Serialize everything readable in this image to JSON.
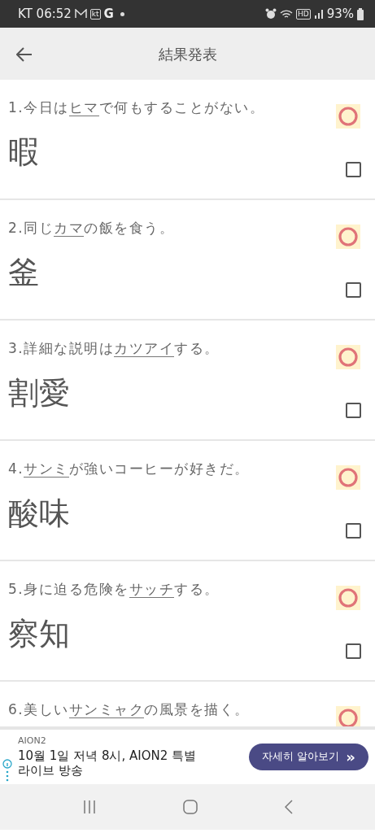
{
  "status_bar": {
    "carrier_time": "KT 06:52",
    "kt_label": "kt",
    "google_label": "G",
    "hd_label": "HD",
    "battery": "93%"
  },
  "header": {
    "title": "結果発表"
  },
  "questions": [
    {
      "number": "1.",
      "before": "今日は",
      "target": "ヒマ",
      "after": "で何もすることがない。",
      "answer": "暇",
      "correct": true,
      "checked": false
    },
    {
      "number": "2.",
      "before": "同じ",
      "target": "カマ",
      "after": "の飯を食う。",
      "answer": "釜",
      "correct": true,
      "checked": false
    },
    {
      "number": "3.",
      "before": "詳細な説明は",
      "target": "カツアイ",
      "after": "する。",
      "answer": "割愛",
      "correct": true,
      "checked": false
    },
    {
      "number": "4.",
      "target": "サンミ",
      "after": "が強いコーヒーが好きだ。",
      "answer": "酸味",
      "correct": true,
      "checked": false
    },
    {
      "number": "5.",
      "before": "身に迫る危険を",
      "target": "サッチ",
      "after": "する。",
      "answer": "察知",
      "correct": true,
      "checked": false
    },
    {
      "number": "6.",
      "before": "美しい",
      "target": "サンミャク",
      "after": "の風景を描く。",
      "correct": true
    }
  ],
  "ad": {
    "advertiser": "AION2",
    "headline": "10월 1일 저녁 8시, AION2 특별 라이브 방송",
    "cta": "자세히 알아보기",
    "cta_arrow": "»"
  }
}
